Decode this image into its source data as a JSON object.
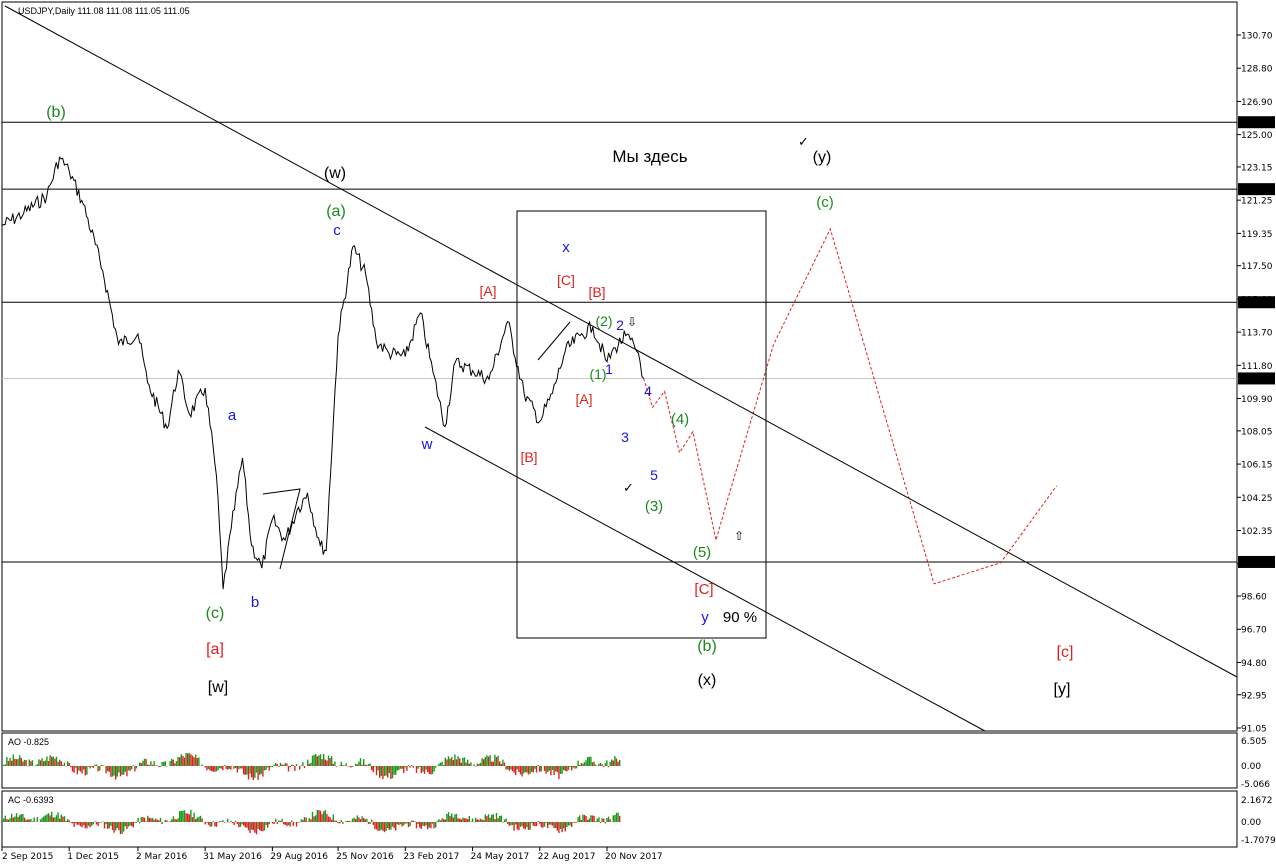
{
  "header": {
    "symbol_line": "USDJPY,Daily  111.08 111.08 111.05 111.05"
  },
  "colors": {
    "black": "#000000",
    "green": "#1a8a1a",
    "blue": "#1515e0",
    "red": "#e02020",
    "ao_up": "#1a9a1a",
    "ao_down": "#e02020"
  },
  "chart_data": [
    {
      "type": "line",
      "title": "USDJPY,Daily",
      "ylim": [
        91.05,
        132.0
      ],
      "y_ticks": [
        "130.70",
        "128.80",
        "126.90",
        "125.00",
        "123.15",
        "121.25",
        "119.35",
        "117.50",
        "115.60",
        "113.70",
        "111.80",
        "109.90",
        "108.05",
        "106.15",
        "104.25",
        "102.35",
        "100.45",
        "98.60",
        "96.70",
        "94.80",
        "92.95",
        "91.05"
      ],
      "x_ticks": [
        "2 Sep 2015",
        "1 Dec 2015",
        "2 Mar 2016",
        "31 May 2016",
        "29 Aug 2016",
        "25 Nov 2016",
        "23 Feb 2017",
        "24 May 2017",
        "22 Aug 2017",
        "20 Nov 2017"
      ],
      "horizontal_levels": [
        {
          "value": 125.71,
          "label": "125.71"
        },
        {
          "value": 121.88,
          "label": "121.88"
        },
        {
          "value": 115.41,
          "label": "115.41"
        },
        {
          "value": 100.55,
          "label": "100.55"
        }
      ],
      "current_price": {
        "value": 111.05,
        "label": "111.05"
      },
      "series": [
        {
          "name": "",
          "x": [
            "2 Sep 2015",
            "1 Oct 2015",
            "1 Nov 2015",
            "18 Nov 2015",
            "1 Dec 2015",
            "20 Dec 2015",
            "15 Jan 2016",
            "5 Feb 2016",
            "2 Mar 2016",
            "15 Mar 2016",
            "10 Apr 2016",
            "25 Apr 2016",
            "10 May 2016",
            "31 May 2016",
            "15 Jun 2016",
            "24 Jun 2016",
            "5 Jul 2016",
            "20 Jul 2016",
            "1 Aug 2016",
            "15 Aug 2016",
            "29 Aug 2016",
            "15 Sep 2016",
            "1 Oct 2016",
            "15 Oct 2016",
            "1 Nov 2016",
            "9 Nov 2016",
            "25 Nov 2016",
            "15 Dec 2016",
            "1 Jan 2017",
            "15 Jan 2017",
            "1 Feb 2017",
            "23 Feb 2017",
            "15 Mar 2017",
            "1 Apr 2017",
            "17 Apr 2017",
            "1 May 2017",
            "24 May 2017",
            "15 Jun 2017",
            "10 Jul 2017",
            "1 Aug 2017",
            "22 Aug 2017",
            "8 Sep 2017",
            "25 Sep 2017",
            "15 Oct 2017",
            "1 Nov 2017",
            "20 Nov 2017",
            "1 Dec 2017",
            "15 Dec 2017",
            "1 Jan 2018",
            "8 Jan 2018"
          ],
          "values": [
            119.8,
            120.5,
            121.5,
            123.7,
            122.9,
            121.0,
            117.2,
            113.0,
            113.6,
            110.8,
            108.2,
            111.5,
            109.0,
            110.5,
            105.5,
            99.0,
            102.5,
            106.5,
            101.5,
            100.2,
            103.0,
            101.8,
            103.5,
            104.5,
            101.5,
            101.2,
            113.5,
            118.6,
            117.0,
            113.2,
            112.5,
            112.3,
            114.8,
            111.4,
            108.3,
            112.0,
            111.5,
            111.0,
            114.3,
            110.2,
            108.6,
            110.2,
            112.6,
            113.5,
            114.0,
            112.0,
            112.8,
            113.5,
            112.5,
            111.05
          ]
        },
        {
          "name": "",
          "x": [
            "8 Jan 2018",
            "20 Jan 2018",
            "5 Feb 2018",
            "25 Feb 2018",
            "15 Mar 2018",
            "15 Apr 2018",
            "1 May 2018",
            "1 Jul 2018",
            "15 Sep 2018",
            "1 Feb 2019",
            "1 May 2019",
            "15 Jul 2019"
          ],
          "values": [
            111.05,
            109.4,
            110.3,
            106.8,
            108.0,
            101.8,
            104.2,
            113.0,
            119.6,
            99.3,
            100.5,
            104.9
          ]
        }
      ],
      "annotations": [
        {
          "text": "(b)",
          "color": "green"
        },
        {
          "text": "(w)",
          "color": "black"
        },
        {
          "text": "(a)",
          "color": "green"
        },
        {
          "text": "c",
          "color": "blue"
        },
        {
          "text": "Мы здесь",
          "color": "black"
        },
        {
          "text": "(y)",
          "color": "black"
        },
        {
          "text": "(c)",
          "color": "green"
        },
        {
          "text": "x",
          "color": "blue"
        },
        {
          "text": "[C]",
          "color": "red"
        },
        {
          "text": "[B]",
          "color": "red"
        },
        {
          "text": "[A]",
          "color": "red"
        },
        {
          "text": "(2)",
          "color": "green"
        },
        {
          "text": "2",
          "color": "blue"
        },
        {
          "text": "1",
          "color": "blue"
        },
        {
          "text": "(1)",
          "color": "green"
        },
        {
          "text": "[A]",
          "color": "red"
        },
        {
          "text": "4",
          "color": "blue"
        },
        {
          "text": "(4)",
          "color": "green"
        },
        {
          "text": "3",
          "color": "blue"
        },
        {
          "text": "5",
          "color": "blue"
        },
        {
          "text": "(3)",
          "color": "green"
        },
        {
          "text": "[B]",
          "color": "red"
        },
        {
          "text": "w",
          "color": "blue"
        },
        {
          "text": "a",
          "color": "blue"
        },
        {
          "text": "b",
          "color": "blue"
        },
        {
          "text": "(c)",
          "color": "green"
        },
        {
          "text": "[a]",
          "color": "red"
        },
        {
          "text": "[w]",
          "color": "black"
        },
        {
          "text": "(5)",
          "color": "green"
        },
        {
          "text": "[C]",
          "color": "red"
        },
        {
          "text": "y",
          "color": "blue"
        },
        {
          "text": "90 %",
          "color": "black"
        },
        {
          "text": "(b)",
          "color": "green"
        },
        {
          "text": "(x)",
          "color": "black"
        },
        {
          "text": "[c]",
          "color": "red"
        },
        {
          "text": "[y]",
          "color": "black"
        }
      ]
    },
    {
      "type": "bar",
      "title": "AO -0.825",
      "ylim": [
        -5.066,
        6.505
      ],
      "y_ticks": [
        "6.505",
        "0.00",
        "-5.066"
      ]
    },
    {
      "type": "bar",
      "title": "AC -0.6393",
      "ylim": [
        -1.7079,
        2.1672
      ],
      "y_ticks": [
        "2.1672",
        "0.00",
        "-1.7079"
      ]
    }
  ]
}
